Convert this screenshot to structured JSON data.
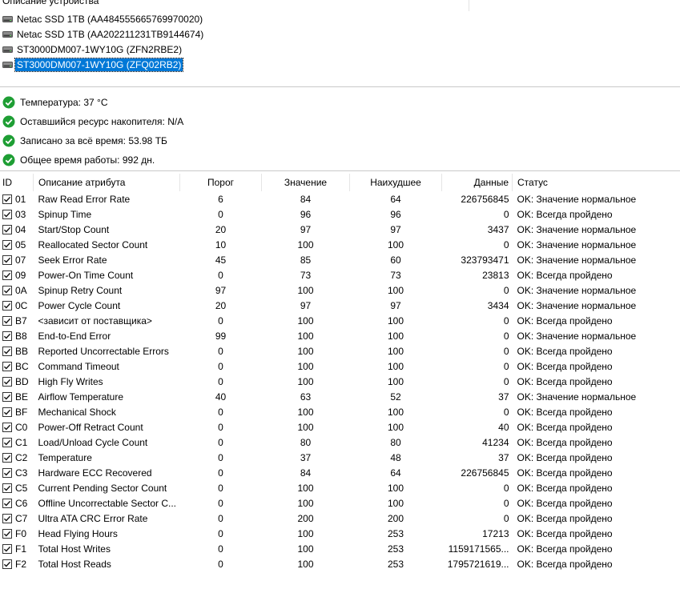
{
  "devices": {
    "header": "Описание устройства",
    "items": [
      {
        "label": "Netac SSD 1TB (AA484555665769970020)",
        "selected": false
      },
      {
        "label": "Netac SSD 1TB (AA202211231TB9144674)",
        "selected": false
      },
      {
        "label": "ST3000DM007-1WY10G (ZFN2RBE2)",
        "selected": false
      },
      {
        "label": "ST3000DM007-1WY10G (ZFQ02RB2)",
        "selected": true
      }
    ]
  },
  "summary": [
    "Температура: 37 °C",
    "Оставшийся ресурс накопителя: N/A",
    "Записано за всё время: 53.98 ТБ",
    "Общее время работы: 992 дн."
  ],
  "table": {
    "headers": [
      "ID",
      "Описание атрибута",
      "Порог",
      "Значение",
      "Наихудшее",
      "Данные",
      "Статус"
    ],
    "rows": [
      [
        "01",
        "Raw Read Error Rate",
        "6",
        "84",
        "64",
        "226756845",
        "OK: Значение нормальное"
      ],
      [
        "03",
        "Spinup Time",
        "0",
        "96",
        "96",
        "0",
        "OK: Всегда пройдено"
      ],
      [
        "04",
        "Start/Stop Count",
        "20",
        "97",
        "97",
        "3437",
        "OK: Значение нормальное"
      ],
      [
        "05",
        "Reallocated Sector Count",
        "10",
        "100",
        "100",
        "0",
        "OK: Значение нормальное"
      ],
      [
        "07",
        "Seek Error Rate",
        "45",
        "85",
        "60",
        "323793471",
        "OK: Значение нормальное"
      ],
      [
        "09",
        "Power-On Time Count",
        "0",
        "73",
        "73",
        "23813",
        "OK: Всегда пройдено"
      ],
      [
        "0A",
        "Spinup Retry Count",
        "97",
        "100",
        "100",
        "0",
        "OK: Значение нормальное"
      ],
      [
        "0C",
        "Power Cycle Count",
        "20",
        "97",
        "97",
        "3434",
        "OK: Значение нормальное"
      ],
      [
        "B7",
        "<зависит от поставщика>",
        "0",
        "100",
        "100",
        "0",
        "OK: Всегда пройдено"
      ],
      [
        "B8",
        "End-to-End Error",
        "99",
        "100",
        "100",
        "0",
        "OK: Значение нормальное"
      ],
      [
        "BB",
        "Reported Uncorrectable Errors",
        "0",
        "100",
        "100",
        "0",
        "OK: Всегда пройдено"
      ],
      [
        "BC",
        "Command Timeout",
        "0",
        "100",
        "100",
        "0",
        "OK: Всегда пройдено"
      ],
      [
        "BD",
        "High Fly Writes",
        "0",
        "100",
        "100",
        "0",
        "OK: Всегда пройдено"
      ],
      [
        "BE",
        "Airflow Temperature",
        "40",
        "63",
        "52",
        "37",
        "OK: Значение нормальное"
      ],
      [
        "BF",
        "Mechanical Shock",
        "0",
        "100",
        "100",
        "0",
        "OK: Всегда пройдено"
      ],
      [
        "C0",
        "Power-Off Retract Count",
        "0",
        "100",
        "100",
        "40",
        "OK: Всегда пройдено"
      ],
      [
        "C1",
        "Load/Unload Cycle Count",
        "0",
        "80",
        "80",
        "41234",
        "OK: Всегда пройдено"
      ],
      [
        "C2",
        "Temperature",
        "0",
        "37",
        "48",
        "37",
        "OK: Всегда пройдено"
      ],
      [
        "C3",
        "Hardware ECC Recovered",
        "0",
        "84",
        "64",
        "226756845",
        "OK: Всегда пройдено"
      ],
      [
        "C5",
        "Current Pending Sector Count",
        "0",
        "100",
        "100",
        "0",
        "OK: Всегда пройдено"
      ],
      [
        "C6",
        "Offline Uncorrectable Sector C...",
        "0",
        "100",
        "100",
        "0",
        "OK: Всегда пройдено"
      ],
      [
        "C7",
        "Ultra ATA CRC Error Rate",
        "0",
        "200",
        "200",
        "0",
        "OK: Всегда пройдено"
      ],
      [
        "F0",
        "Head Flying Hours",
        "0",
        "100",
        "253",
        "17213",
        "OK: Всегда пройдено"
      ],
      [
        "F1",
        "Total Host Writes",
        "0",
        "100",
        "253",
        "1159171565...",
        "OK: Всегда пройдено"
      ],
      [
        "F2",
        "Total Host Reads",
        "0",
        "100",
        "253",
        "1795721619...",
        "OK: Всегда пройдено"
      ]
    ]
  },
  "icons": {
    "device": "drive-icon",
    "summary": "ok-check-icon",
    "row": "checkbox-checked-icon"
  },
  "colors": {
    "selection": "#0078d7",
    "ok_green": "#1e9e34"
  }
}
